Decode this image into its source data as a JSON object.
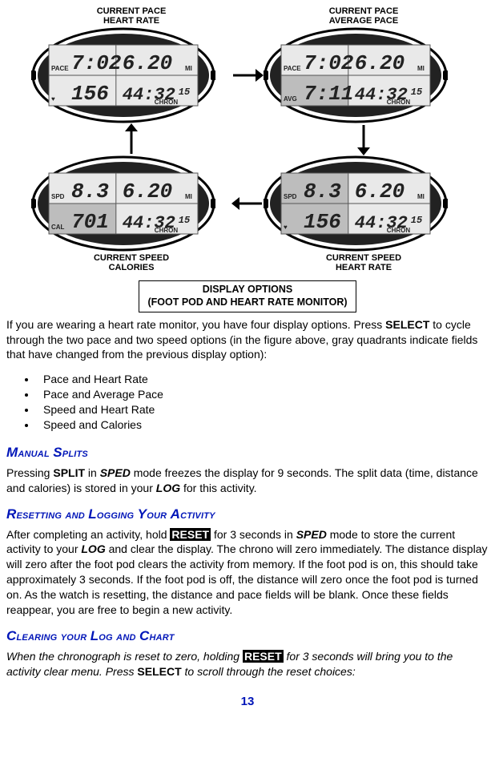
{
  "figure": {
    "top_left_label_l1": "CURRENT PACE",
    "top_left_label_l2": "HEART RATE",
    "top_right_label_l1": "CURRENT PACE",
    "top_right_label_l2": "AVERAGE PACE",
    "bottom_left_label_l1": "CURRENT SPEED",
    "bottom_left_label_l2": "CALORIES",
    "bottom_right_label_l1": "CURRENT SPEED",
    "bottom_right_label_l2": "HEART RATE",
    "caption_l1": "DISPLAY OPTIONS",
    "caption_l2": "(FOOT POD AND HEART RATE MONITOR)",
    "watches": {
      "tl": {
        "row1": {
          "left_lbl": "PACE",
          "left": "7:02",
          "right": "6.20",
          "unit": "MI",
          "left_hl": false,
          "right_hl": false
        },
        "row2": {
          "left_lbl": "♥",
          "left": "156",
          "right": "44:32",
          "right_sup": "15",
          "sub": "CHRON",
          "left_hl": false,
          "right_hl": false
        }
      },
      "tr": {
        "row1": {
          "left_lbl": "PACE",
          "left": "7:02",
          "right": "6.20",
          "unit": "MI",
          "left_hl": false,
          "right_hl": false
        },
        "row2": {
          "left_lbl": "AVG",
          "left": "7:11",
          "right": "44:32",
          "right_sup": "15",
          "sub": "CHRON",
          "left_hl": true,
          "right_hl": false
        }
      },
      "br": {
        "row1": {
          "left_lbl": "SPD",
          "left": "8.3",
          "right": "6.20",
          "unit": "MI",
          "left_hl": true,
          "right_hl": false
        },
        "row2": {
          "left_lbl": "♥",
          "left": "156",
          "right": "44:32",
          "right_sup": "15",
          "sub": "CHRON",
          "left_hl": true,
          "right_hl": false
        }
      },
      "bl": {
        "row1": {
          "left_lbl": "SPD",
          "left": "8.3",
          "right": "6.20",
          "unit": "MI",
          "left_hl": false,
          "right_hl": false
        },
        "row2": {
          "left_lbl": "CAL",
          "left": "701",
          "right": "44:32",
          "right_sup": "15",
          "sub": "CHRON",
          "left_hl": true,
          "right_hl": false
        }
      }
    }
  },
  "intro": {
    "p1_a": "If you are wearing a heart rate monitor, you have four display options.  Press ",
    "p1_b": "SELECT",
    "p1_c": " to cycle through the two pace and two speed options (in the figure above, gray quadrants indicate fields that have changed from the previous display option):",
    "bullets": [
      "Pace and Heart Rate",
      "Pace and Average Pace",
      "Speed and Heart Rate",
      "Speed and Calories"
    ]
  },
  "sec1": {
    "heading": "Manual Splits",
    "a": "Pressing ",
    "b": "SPLIT",
    "c": " in ",
    "d": "SPED",
    "e": " mode freezes the display for 9 seconds.  The split data (time, distance and calories) is stored in your ",
    "f": "LOG",
    "g": " for this activity."
  },
  "sec2": {
    "heading": "Resetting and Logging Your Activity",
    "a": "After completing an activity, hold ",
    "b": "RESET",
    "c": " for 3 seconds in ",
    "d": "SPED",
    "e": " mode to store the current activity to your ",
    "f": "LOG",
    "g": " and clear the display.  The chrono will zero immediately.  The distance display will zero after the foot pod clears the activity from memory.  If the foot pod is on, this should take approximately 3 seconds.  If the foot pod is off, the distance will zero once the foot pod is turned on.  As the watch is resetting, the distance and pace fields will be blank.  Once these fields reappear, you are free to begin a new activity."
  },
  "sec3": {
    "heading": "Clearing your Log and Chart",
    "a": "When the chronograph is reset to zero, holding ",
    "b": "RESET",
    "c": " for 3 seconds will bring you to the activity clear menu.  Press ",
    "d": "SELECT",
    "e": " to scroll through the reset choices:"
  },
  "page_number": "13"
}
